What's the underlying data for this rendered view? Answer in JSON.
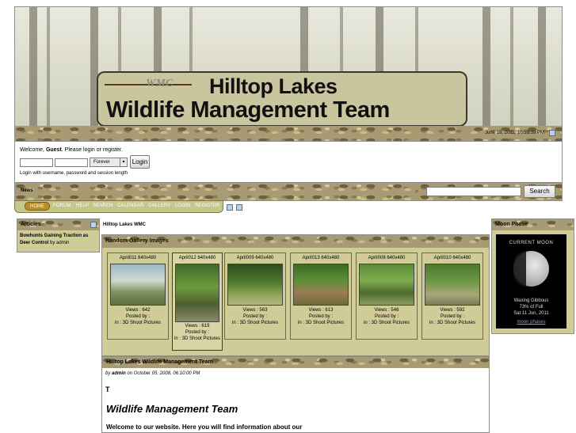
{
  "header": {
    "logo_small": "WMC",
    "title_line1": "Hilltop Lakes",
    "title_line2": "Wildlife Management Team",
    "datetime": "June 18, 2011, 10:53:39 PM"
  },
  "login": {
    "welcome_prefix": "Welcome, ",
    "welcome_user": "Guest",
    "welcome_suffix": ". Please login or register.",
    "session_select": "Forever",
    "login_button": "Login",
    "hint": "Login with username, password and session length"
  },
  "newsbar": {
    "label": "News",
    "search_button": "Search"
  },
  "menu": {
    "items": [
      "HOME",
      "FORUM",
      "HELP",
      "SEARCH",
      "CALENDAR",
      "GALLERY",
      "LOGIN",
      "REGISTER"
    ]
  },
  "articles_block": {
    "title": "Articles",
    "link": "Bowhunts Gaining Traction as Deer Control",
    "by": " by admin"
  },
  "center": {
    "crumb": "Hilltop Lakes WMC",
    "gallery_title": "Random Gallery Images",
    "thumbs": [
      {
        "caption": "April011 640x480",
        "views": "Views : 642",
        "posted": "Posted by :",
        "in": "in : 3D Shoot Pictures"
      },
      {
        "caption": "April012 640x480",
        "views": "Views : 619",
        "posted": "Posted by :",
        "in": "in : 3D Shoot Pictures"
      },
      {
        "caption": "April009 640x480",
        "views": "Views : 563",
        "posted": "Posted by :",
        "in": "in : 3D Shoot Pictures"
      },
      {
        "caption": "April013 640x480",
        "views": "Views : 613",
        "posted": "Posted by :",
        "in": "in : 3D Shoot Pictures"
      },
      {
        "caption": "April008 640x480",
        "views": "Views : 546",
        "posted": "Posted by :",
        "in": "in : 3D Shoot Pictures"
      },
      {
        "caption": "April010 640x480",
        "views": "Views : 592",
        "posted": "Posted by :",
        "in": "in : 3D Shoot Pictures"
      }
    ],
    "article_title": "Hilltop Lakes Wildlife Management Team",
    "article_by": "by",
    "article_author": "admin",
    "article_date": " on October 05, 2008, 06:10:00 PM",
    "article_dropcap": "T",
    "article_heading": "Wildlife Management Team",
    "article_text": "Welcome to our website. Here you will find information about our"
  },
  "moon_block": {
    "title": "Moon Phase",
    "widget_title": "CURRENT MOON",
    "phase": "Waxing Gibbous",
    "percent": "73% of Full",
    "date": "Sat 11 Jun, 2011",
    "link": "moon phases"
  }
}
